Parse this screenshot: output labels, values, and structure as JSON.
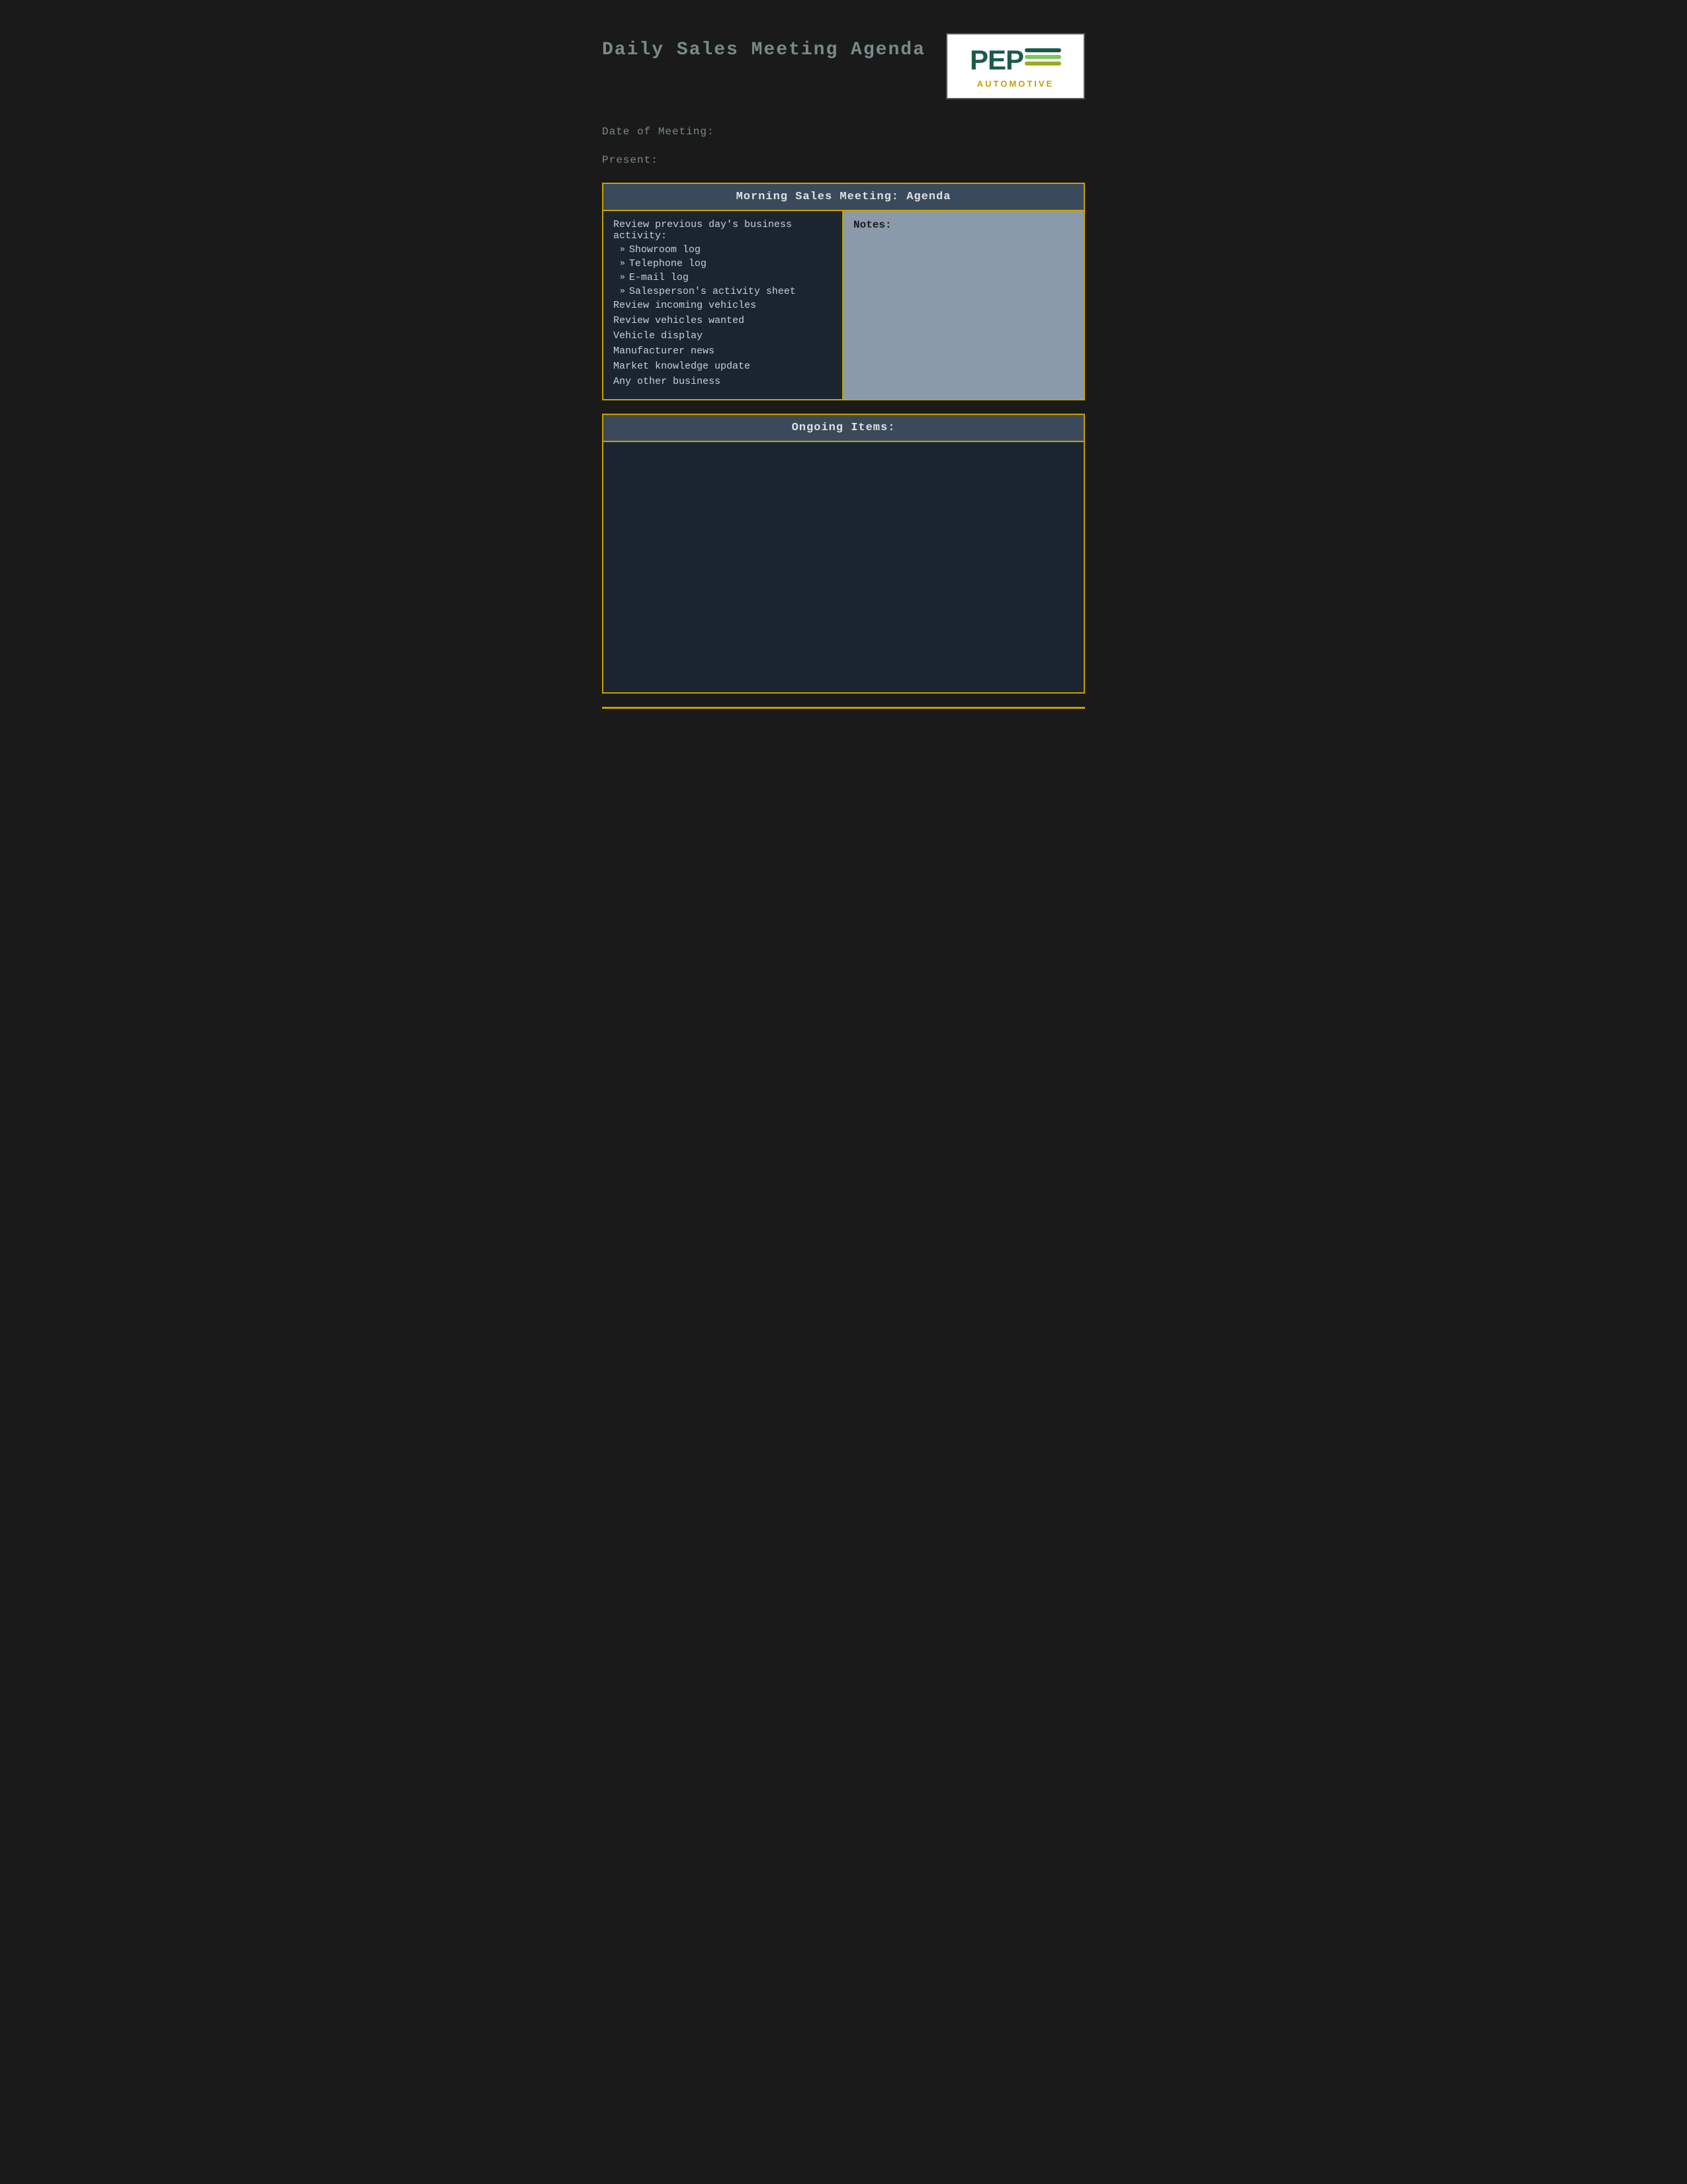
{
  "header": {
    "title": "Daily Sales Meeting Agenda",
    "logo": {
      "name": "PEP",
      "tagline": "AUTOMOTIVE"
    }
  },
  "meta": {
    "date_label": "Date of Meeting:",
    "present_label": "Present:"
  },
  "morning_section": {
    "header": "Morning Sales Meeting: Agenda",
    "left_column": {
      "intro": "Review previous day's business activity:",
      "bullet_items": [
        "Showroom log",
        "Telephone log",
        "E-mail log",
        "Salesperson's activity sheet"
      ],
      "items": [
        "Review incoming vehicles",
        "Review vehicles wanted",
        "Vehicle display",
        "Manufacturer news",
        "Market knowledge update",
        "Any other business"
      ]
    },
    "right_column": {
      "label": "Notes:"
    }
  },
  "ongoing_section": {
    "header": "Ongoing Items:"
  }
}
